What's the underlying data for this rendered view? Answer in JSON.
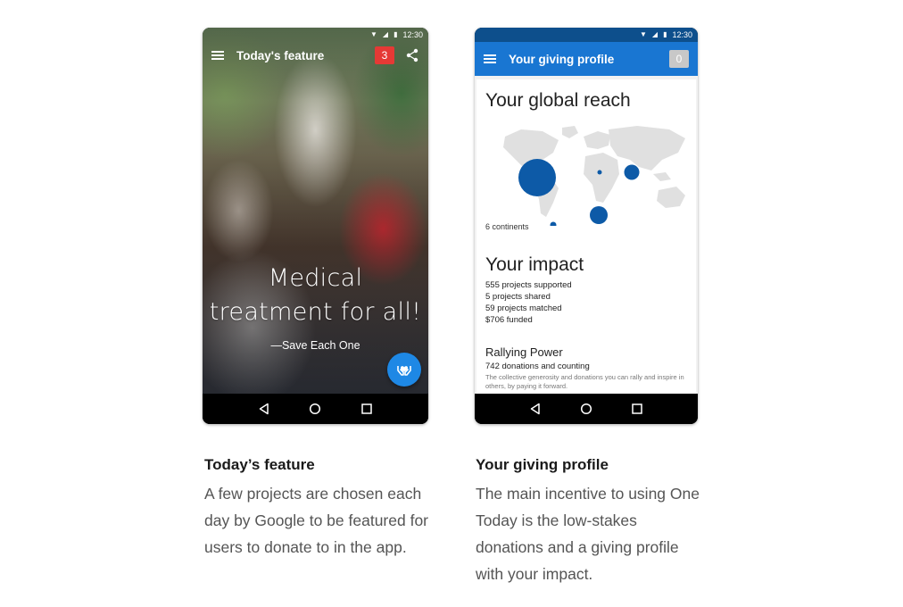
{
  "left_phone": {
    "status_time": "12:30",
    "title": "Today's feature",
    "notification_count": "3",
    "headline_line1": "Medical",
    "headline_line2": "treatment for all!",
    "source": "—Save Each One"
  },
  "right_phone": {
    "status_time": "12:30",
    "title": "Your giving profile",
    "badge_count": "0",
    "reach_title": "Your global reach",
    "continents": "6 continents",
    "impact_title": "Your impact",
    "impact_items": [
      "555 projects supported",
      "5 projects shared",
      "59 projects matched",
      "$706 funded"
    ],
    "rally_title": "Rallying Power",
    "rally_count": "742 donations and counting",
    "rally_desc": "The collective generosity and donations you can rally and inspire in others, by paying it forward."
  },
  "captions": {
    "left": {
      "title": "Today’s feature",
      "body": "A few projects are chosen each day by Google to be featured for users to donate to in the app."
    },
    "right": {
      "title": "Your giving profile",
      "body": "The main incentive to using One Today is the low-stakes donations and a giving profile with your impact."
    }
  },
  "colors": {
    "app_blue": "#1976d2",
    "status_blue": "#0d4f8c",
    "badge_red": "#e53935",
    "map_dot": "#0d5aa7",
    "map_land": "#e0e0e0"
  },
  "icons": {
    "menu": "menu-icon",
    "share": "share-icon",
    "fab": "hands-heart-icon",
    "back": "back-icon",
    "home": "home-icon",
    "recents": "recents-icon"
  }
}
